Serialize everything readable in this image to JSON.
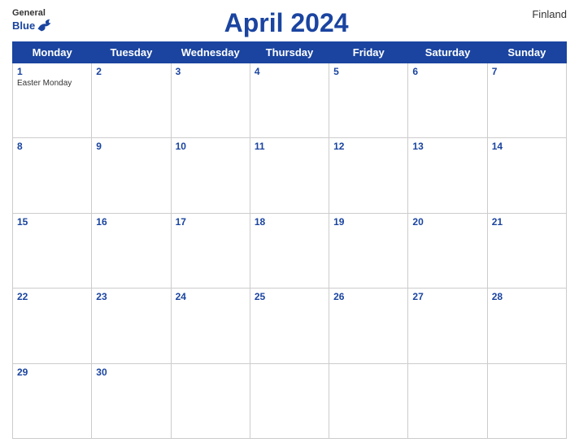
{
  "header": {
    "logo_general": "General",
    "logo_blue": "Blue",
    "month": "April 2024",
    "country": "Finland"
  },
  "days_of_week": [
    "Monday",
    "Tuesday",
    "Wednesday",
    "Thursday",
    "Friday",
    "Saturday",
    "Sunday"
  ],
  "weeks": [
    [
      {
        "day": "1",
        "holiday": "Easter Monday"
      },
      {
        "day": "2",
        "holiday": ""
      },
      {
        "day": "3",
        "holiday": ""
      },
      {
        "day": "4",
        "holiday": ""
      },
      {
        "day": "5",
        "holiday": ""
      },
      {
        "day": "6",
        "holiday": ""
      },
      {
        "day": "7",
        "holiday": ""
      }
    ],
    [
      {
        "day": "8",
        "holiday": ""
      },
      {
        "day": "9",
        "holiday": ""
      },
      {
        "day": "10",
        "holiday": ""
      },
      {
        "day": "11",
        "holiday": ""
      },
      {
        "day": "12",
        "holiday": ""
      },
      {
        "day": "13",
        "holiday": ""
      },
      {
        "day": "14",
        "holiday": ""
      }
    ],
    [
      {
        "day": "15",
        "holiday": ""
      },
      {
        "day": "16",
        "holiday": ""
      },
      {
        "day": "17",
        "holiday": ""
      },
      {
        "day": "18",
        "holiday": ""
      },
      {
        "day": "19",
        "holiday": ""
      },
      {
        "day": "20",
        "holiday": ""
      },
      {
        "day": "21",
        "holiday": ""
      }
    ],
    [
      {
        "day": "22",
        "holiday": ""
      },
      {
        "day": "23",
        "holiday": ""
      },
      {
        "day": "24",
        "holiday": ""
      },
      {
        "day": "25",
        "holiday": ""
      },
      {
        "day": "26",
        "holiday": ""
      },
      {
        "day": "27",
        "holiday": ""
      },
      {
        "day": "28",
        "holiday": ""
      }
    ],
    [
      {
        "day": "29",
        "holiday": ""
      },
      {
        "day": "30",
        "holiday": ""
      },
      {
        "day": "",
        "holiday": ""
      },
      {
        "day": "",
        "holiday": ""
      },
      {
        "day": "",
        "holiday": ""
      },
      {
        "day": "",
        "holiday": ""
      },
      {
        "day": "",
        "holiday": ""
      }
    ]
  ]
}
